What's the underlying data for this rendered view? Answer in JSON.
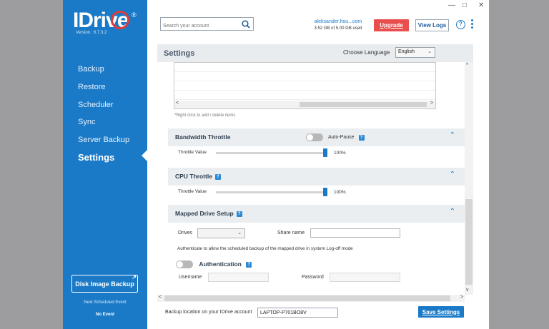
{
  "app": {
    "logo_text": "IDriv",
    "logo_e": "e",
    "logo_reg": "®",
    "version": "Version : 6.7.3.2"
  },
  "window_controls": {
    "minimize": "—",
    "maximize": "□",
    "close": "✕"
  },
  "sidebar": {
    "items": [
      {
        "label": "Backup",
        "active": false
      },
      {
        "label": "Restore",
        "active": false
      },
      {
        "label": "Scheduler",
        "active": false
      },
      {
        "label": "Sync",
        "active": false
      },
      {
        "label": "Server Backup",
        "active": false
      },
      {
        "label": "Settings",
        "active": true
      }
    ],
    "disk_image_button": "Disk Image Backup",
    "next_event_label": "Next Scheduled Event",
    "next_event_value": "No Event"
  },
  "header": {
    "search_placeholder": "Search your account",
    "account": "aleksander.hou...com",
    "usage": "3.52 GB of 5.00 GB used",
    "upgrade": "Upgrade",
    "view_logs": "View Logs",
    "help": "?"
  },
  "settings": {
    "title": "Settings",
    "language_label": "Choose Language",
    "language_value": "English",
    "list_hint": "*Right click to add / delete items",
    "bandwidth": {
      "title": "Bandwidth Throttle",
      "auto_pause_label": "Auto-Pause",
      "auto_pause_on": false,
      "throttle_label": "Throttle Value",
      "throttle_value": "100%"
    },
    "cpu": {
      "title": "CPU Throttle",
      "throttle_label": "Throttle Value",
      "throttle_value": "100%"
    },
    "mapped_drive": {
      "title": "Mapped Drive Setup",
      "drives_label": "Drives",
      "share_name_label": "Share name",
      "auth_note": "Authenticate to allow the scheduled backup of the mapped drive in system Log-off mode",
      "auth_label": "Authentication",
      "auth_on": false,
      "username_label": "Username",
      "password_label": "Password"
    },
    "backup_location_label": "Backup location on your IDrive account",
    "backup_location_value": "LAPTOP-P701BO8V",
    "save_button": "Save Settings"
  },
  "colors": {
    "sidebar": "#1a7ac8",
    "upgrade": "#e94e4e",
    "accent": "#1a7ac8",
    "section_bg": "#eaeef1"
  },
  "icons": {
    "search": "search-icon",
    "help": "help-icon",
    "menu": "kebab-menu-icon",
    "collapse": "chevron-up-icon",
    "info": "question-icon",
    "external": "external-link-icon"
  }
}
